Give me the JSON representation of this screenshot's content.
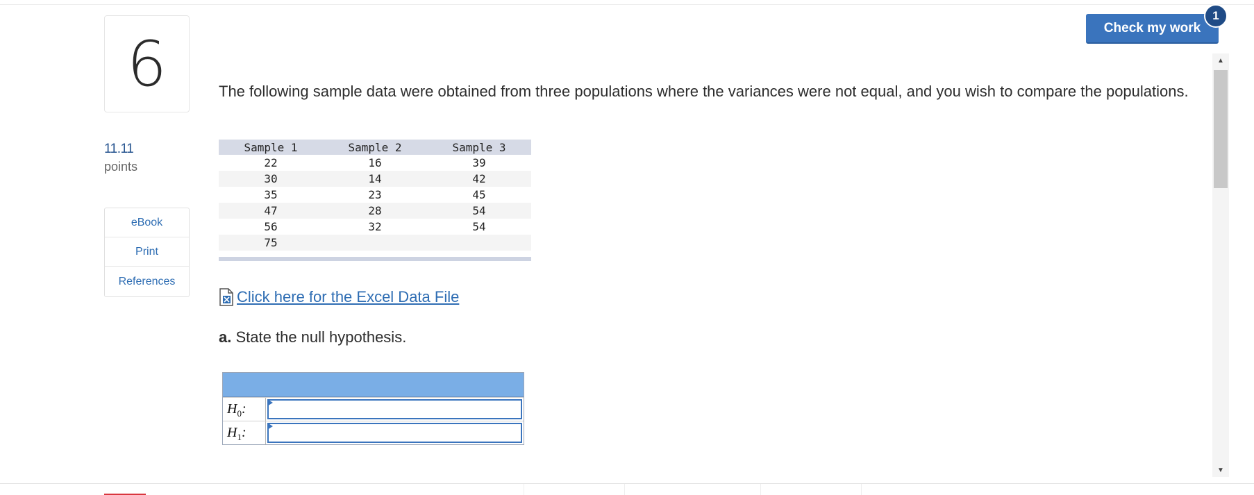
{
  "question": {
    "number": "6",
    "points_value": "11.11",
    "points_label": "points",
    "text": "The following sample data were obtained from three populations where the variances were not equal, and you wish to compare the populations."
  },
  "resources": {
    "items": [
      {
        "label": "eBook"
      },
      {
        "label": "Print"
      },
      {
        "label": "References"
      }
    ]
  },
  "check_work": {
    "label": "Check my work",
    "badge": "1"
  },
  "sample_table": {
    "headers": [
      "Sample 1",
      "Sample 2",
      "Sample 3"
    ],
    "rows": [
      [
        "22",
        "16",
        "39"
      ],
      [
        "30",
        "14",
        "42"
      ],
      [
        "35",
        "23",
        "45"
      ],
      [
        "47",
        "28",
        "54"
      ],
      [
        "56",
        "32",
        "54"
      ],
      [
        "75",
        "",
        ""
      ]
    ]
  },
  "excel_link": {
    "label": " Click here for the Excel Data File",
    "icon": "excel-file-icon"
  },
  "part_a": {
    "letter": "a.",
    "prompt": "State the null hypothesis."
  },
  "hypotheses": {
    "h0": {
      "symbol": "H",
      "sub": "0",
      "suffix": ":",
      "value": ""
    },
    "h1": {
      "symbol": "H",
      "sub": "1",
      "suffix": ":",
      "value": ""
    }
  },
  "colors": {
    "accent": "#3a74bd",
    "link": "#2e6db3",
    "badge": "#1f4b86",
    "table_header": "#d6dae6",
    "hyp_header": "#7aaee6"
  }
}
